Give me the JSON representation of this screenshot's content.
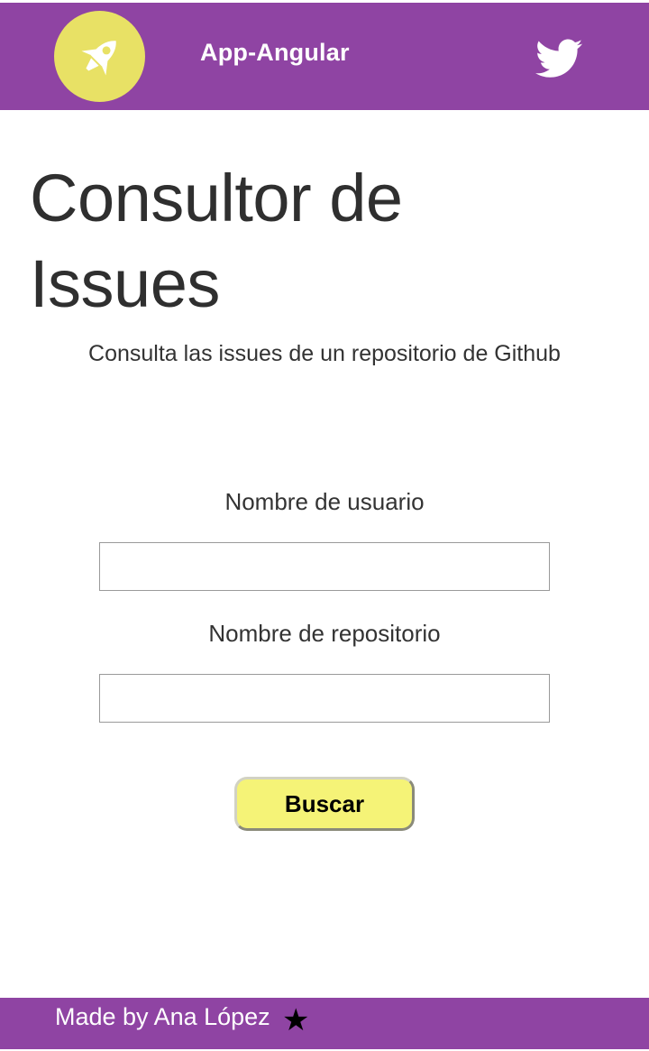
{
  "header": {
    "app_title": "App-Angular",
    "logo_icon": "rocket-icon",
    "social_icon": "twitter-icon"
  },
  "main": {
    "title": "Consultor de Issues",
    "subtitle": "Consulta las issues de un repositorio de Github",
    "user_label": "Nombre de usuario",
    "user_value": "",
    "repo_label": "Nombre de repositorio",
    "repo_value": "",
    "search_button": "Buscar"
  },
  "footer": {
    "text": "Made by Ana López",
    "star_icon": "★"
  },
  "colors": {
    "brand_purple": "#8f44a3",
    "logo_yellow": "#e8e165",
    "button_yellow": "#f5f377",
    "text_dark": "#2f2f2f"
  }
}
